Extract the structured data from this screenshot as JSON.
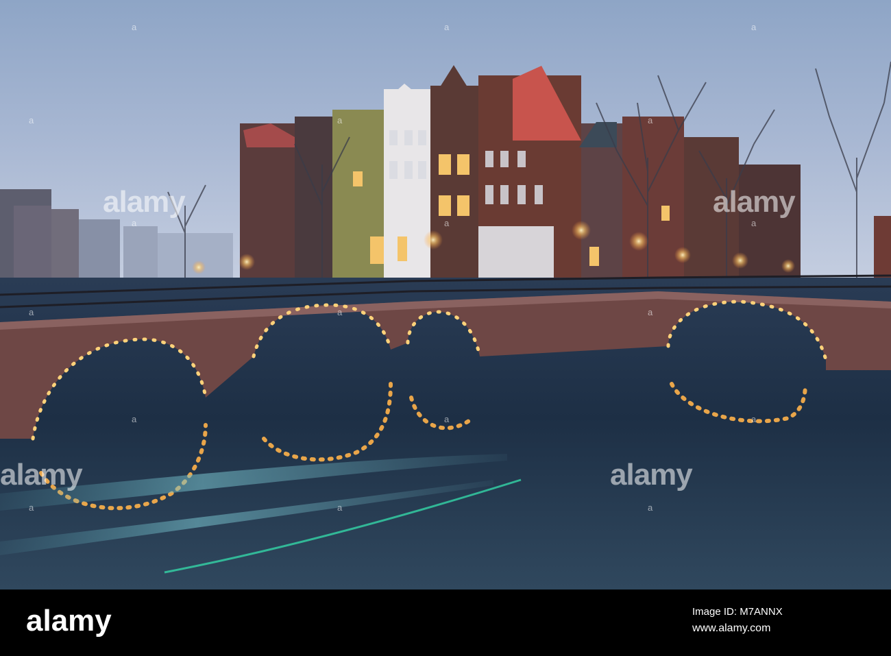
{
  "watermark": {
    "text": "alamy",
    "mark": "a"
  },
  "footer": {
    "logo_text": "alamy",
    "image_id": "Image ID: M7ANNX",
    "website": "www.alamy.com"
  },
  "colors": {
    "sky_top": "#9fb4d2",
    "sky_bottom": "#c4cfe2",
    "water": "#1c3046",
    "brick": "#7a4c48",
    "lamp": "#ffd27a",
    "light_trail": "#3fd6c8"
  }
}
